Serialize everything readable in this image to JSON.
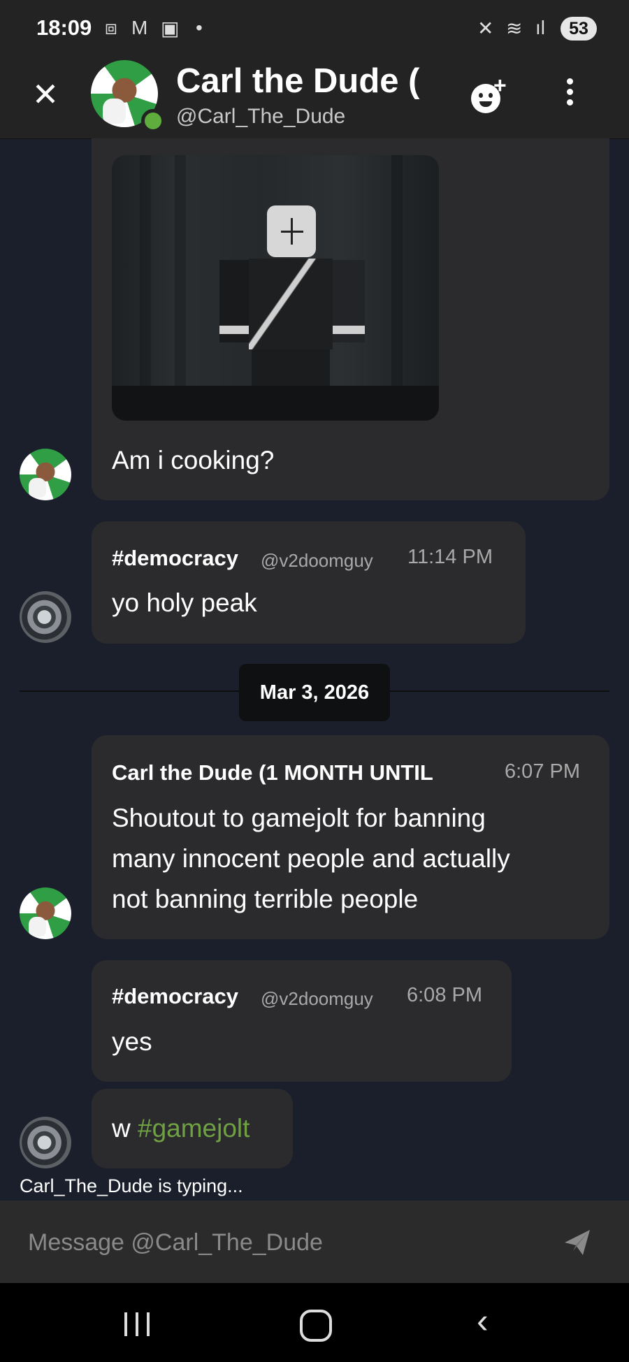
{
  "status_bar": {
    "time": "18:09",
    "notification_icons": [
      "screenshot-icon",
      "gmail-icon",
      "teams-icon",
      "dot"
    ],
    "right_icons": [
      "mute-icon",
      "wifi-icon",
      "signal-icon"
    ],
    "battery": "53"
  },
  "header": {
    "title": "Carl the Dude (",
    "subtitle": "@Carl_The_Dude",
    "online": true
  },
  "messages": [
    {
      "author_avatar": "carl",
      "has_image": true,
      "text": "Am i cooking?"
    },
    {
      "author_avatar": "v2doomguy",
      "name": "#democracy",
      "handle": "@v2doomguy",
      "time": "11:14 PM",
      "text": "yo holy peak"
    },
    {
      "author_avatar": "carl",
      "name": "Carl the Dude (1 MONTH UNTIL",
      "time": "6:07 PM",
      "lines": [
        "Shoutout to gamejolt for banning",
        "many innocent people and actually",
        "not banning terrible people"
      ]
    },
    {
      "author_avatar": "v2doomguy",
      "name": "#democracy",
      "handle": "@v2doomguy",
      "time": "6:08 PM",
      "text": "yes"
    },
    {
      "author_avatar": "v2doomguy",
      "text_prefix": "w ",
      "mention": "#gamejolt"
    }
  ],
  "date_divider": "Mar 3, 2026",
  "typing_indicator": "Carl_The_Dude is typing...",
  "composer": {
    "placeholder": "Message @Carl_The_Dude"
  },
  "colors": {
    "background": "#1a1f2b",
    "bubble": "#2b2b2d",
    "mention": "#6fa043",
    "online": "#5fae3d"
  }
}
